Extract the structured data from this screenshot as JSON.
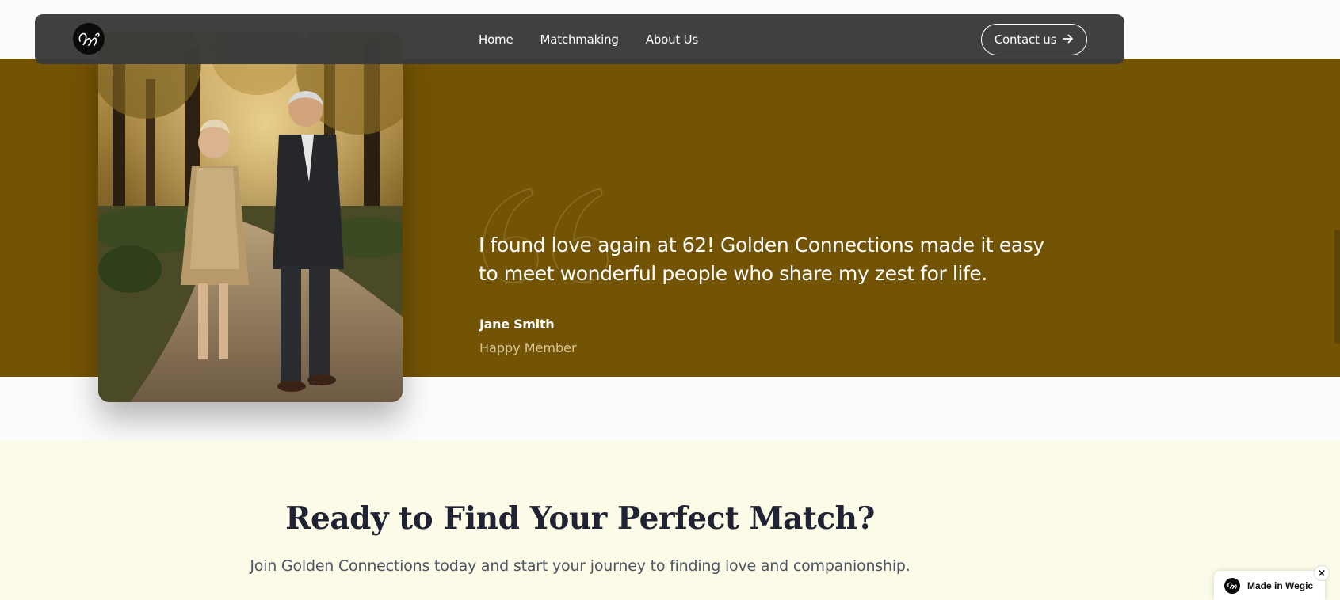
{
  "nav": {
    "logo_icon": "wegic-logo-icon",
    "links": [
      {
        "label": "Home"
      },
      {
        "label": "Matchmaking"
      },
      {
        "label": "About Us"
      }
    ],
    "contact_label": "Contact us",
    "contact_icon": "arrow-right-icon"
  },
  "testimonial": {
    "quote": "I found love again at 62! Golden Connections made it easy to meet wonderful people who share my zest for life.",
    "author_name": "Jane Smith",
    "author_role": "Happy Member",
    "band_color": "#735304",
    "photo_icon": "couple-walking-photo"
  },
  "cta": {
    "title": "Ready to Find Your Perfect Match?",
    "subtitle": "Join Golden Connections today and start your journey to finding love and companionship."
  },
  "badge": {
    "label": "Made in Wegic",
    "close_label": "×"
  }
}
